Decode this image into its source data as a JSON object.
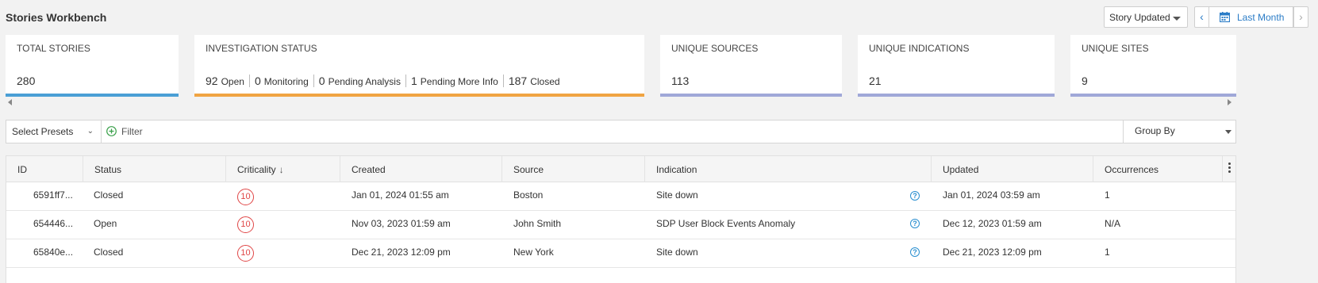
{
  "header": {
    "title": "Stories Workbench",
    "sort_label": "Story Updated",
    "date_range_label": "Last Month",
    "prev_label": "‹",
    "next_label": "›"
  },
  "cards": {
    "total_stories": {
      "label": "TOTAL STORIES",
      "value": "280",
      "color": "#4a9fd5"
    },
    "investigation_status": {
      "label": "INVESTIGATION STATUS",
      "color": "#f0a443",
      "items": [
        {
          "count": "92",
          "label": "Open"
        },
        {
          "count": "0",
          "label": "Monitoring"
        },
        {
          "count": "0",
          "label": "Pending Analysis"
        },
        {
          "count": "1",
          "label": "Pending More Info"
        },
        {
          "count": "187",
          "label": "Closed"
        }
      ]
    },
    "unique_sources": {
      "label": "UNIQUE SOURCES",
      "value": "113",
      "color": "#a0a8d8"
    },
    "unique_indications": {
      "label": "UNIQUE INDICATIONS",
      "value": "21",
      "color": "#a0a8d8"
    },
    "unique_sites": {
      "label": "UNIQUE SITES",
      "value": "9",
      "color": "#a0a8d8"
    }
  },
  "filter_bar": {
    "presets_label": "Select Presets",
    "filter_label": "Filter",
    "group_by_label": "Group By"
  },
  "table": {
    "columns": [
      "ID",
      "Status",
      "Criticality",
      "Created",
      "Source",
      "Indication",
      "Updated",
      "Occurrences"
    ],
    "sort_arrow": "↓",
    "rows": [
      {
        "id": "6591ff7...",
        "status": "Closed",
        "criticality": "10",
        "created": "Jan 01, 2024 01:55 am",
        "source": "Boston",
        "indication": "Site down",
        "help": "?",
        "updated": "Jan 01, 2024 03:59 am",
        "occurrences": "1"
      },
      {
        "id": "654446...",
        "status": "Open",
        "criticality": "10",
        "created": "Nov 03, 2023 01:59 am",
        "source": "John Smith",
        "indication": "SDP User Block Events Anomaly",
        "help": "?",
        "updated": "Dec 12, 2023 01:59 am",
        "occurrences": "N/A"
      },
      {
        "id": "65840e...",
        "status": "Closed",
        "criticality": "10",
        "created": "Dec 21, 2023 12:09 pm",
        "source": "New York",
        "indication": "Site down",
        "help": "?",
        "updated": "Dec 21, 2023 12:09 pm",
        "occurrences": "1"
      }
    ]
  }
}
